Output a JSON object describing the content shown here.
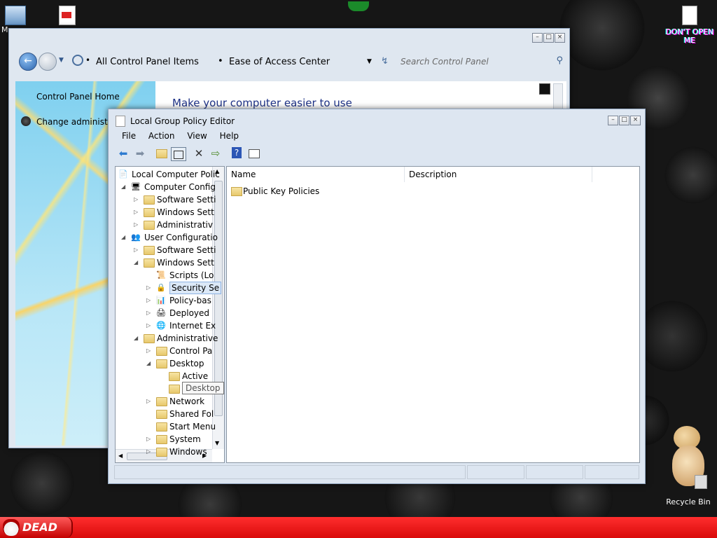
{
  "desktop": {
    "icons": [
      {
        "label": "My"
      },
      {
        "label": ""
      },
      {
        "label": "DON'T OPEN ME"
      },
      {
        "label": "Recycle Bin"
      }
    ]
  },
  "taskbar": {
    "start_label": "DEAD",
    "color": "#e01010"
  },
  "control_panel": {
    "breadcrumb_1": "All Control Panel Items",
    "breadcrumb_sep": "•",
    "breadcrumb_2": "Ease of Access Center",
    "search_placeholder": "Search Control Panel",
    "left_links": [
      "Control Panel Home",
      "Change administrat"
    ],
    "content_heading": "Make your computer easier to use"
  },
  "gpedit": {
    "title": "Local Group Policy Editor",
    "menu": [
      "File",
      "Action",
      "View",
      "Help"
    ],
    "toolbar_icons": [
      "back-arrow-icon",
      "forward-arrow-icon",
      "up-folder-icon",
      "show-hide-tree-icon",
      "delete-icon",
      "export-list-icon",
      "help-icon",
      "properties-icon"
    ],
    "tree": [
      {
        "label": "Local Computer Polic",
        "level": 0,
        "expander": "",
        "icon": "policy"
      },
      {
        "label": "Computer Config",
        "level": 1,
        "expander": "◢",
        "icon": "computer"
      },
      {
        "label": "Software Setti",
        "level": 2,
        "expander": "▷",
        "icon": "folder"
      },
      {
        "label": "Windows Sett",
        "level": 2,
        "expander": "▷",
        "icon": "folder"
      },
      {
        "label": "Administrativ",
        "level": 2,
        "expander": "▷",
        "icon": "folder"
      },
      {
        "label": "User Configuratio",
        "level": 1,
        "expander": "◢",
        "icon": "users"
      },
      {
        "label": "Software Setti",
        "level": 2,
        "expander": "▷",
        "icon": "folder"
      },
      {
        "label": "Windows Sett",
        "level": 2,
        "expander": "◢",
        "icon": "folder"
      },
      {
        "label": "Scripts (Lo",
        "level": 3,
        "expander": "",
        "icon": "script"
      },
      {
        "label": "Security Se",
        "level": 3,
        "expander": "▷",
        "icon": "security",
        "selected": true
      },
      {
        "label": "Policy-bas",
        "level": 3,
        "expander": "▷",
        "icon": "chart"
      },
      {
        "label": "Deployed",
        "level": 3,
        "expander": "▷",
        "icon": "printer"
      },
      {
        "label": "Internet Ex",
        "level": 3,
        "expander": "▷",
        "icon": "ie"
      },
      {
        "label": "Administrative",
        "level": 2,
        "expander": "◢",
        "icon": "folder"
      },
      {
        "label": "Control Pa",
        "level": 3,
        "expander": "▷",
        "icon": "folder"
      },
      {
        "label": "Desktop",
        "level": 3,
        "expander": "◢",
        "icon": "folder"
      },
      {
        "label": "Active",
        "level": 4,
        "expander": "",
        "icon": "folder"
      },
      {
        "label": "",
        "level": 4,
        "expander": "",
        "icon": "folder"
      },
      {
        "label": "Network",
        "level": 3,
        "expander": "▷",
        "icon": "folder"
      },
      {
        "label": "Shared Fol",
        "level": 3,
        "expander": "",
        "icon": "folder"
      },
      {
        "label": "Start Menu",
        "level": 3,
        "expander": "",
        "icon": "folder"
      },
      {
        "label": "System",
        "level": 3,
        "expander": "▷",
        "icon": "folder"
      },
      {
        "label": "Windows",
        "level": 3,
        "expander": "▷",
        "icon": "folder"
      }
    ],
    "tooltip": "Desktop",
    "columns": [
      "Name",
      "Description"
    ],
    "rows": [
      {
        "name": "Public Key Policies",
        "description": ""
      }
    ]
  }
}
